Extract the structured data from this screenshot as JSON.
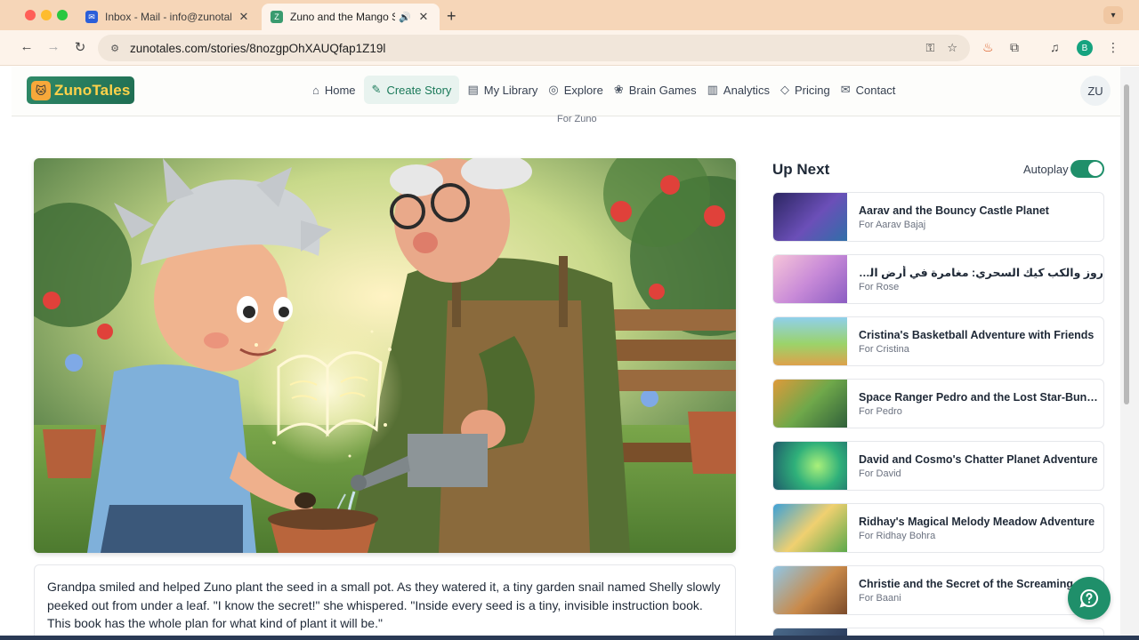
{
  "browser": {
    "tabs": [
      {
        "title": "Inbox - Mail - info@zunotales",
        "close": "✕"
      },
      {
        "title": "Zuno and the Mango Seed",
        "close": "✕"
      }
    ],
    "new_tab": "+",
    "url": "zunotales.com/stories/8nozgpOhXAUQfap1Z19l",
    "profile_initial": "B"
  },
  "site": {
    "logo_text": "ZunoTales",
    "nav": [
      {
        "label": "Home",
        "icon": "home-icon"
      },
      {
        "label": "Create Story",
        "icon": "magic-wand-icon"
      },
      {
        "label": "My Library",
        "icon": "book-icon"
      },
      {
        "label": "Explore",
        "icon": "compass-icon"
      },
      {
        "label": "Brain Games",
        "icon": "brain-icon"
      },
      {
        "label": "Analytics",
        "icon": "chart-icon"
      },
      {
        "label": "Pricing",
        "icon": "diamond-icon"
      },
      {
        "label": "Contact",
        "icon": "mail-icon"
      }
    ],
    "avatar_initials": "ZU",
    "story_for": "For Zuno"
  },
  "story": {
    "text": "Grandpa smiled and helped Zuno plant the seed in a small pot. As they watered it, a tiny garden snail named Shelly slowly peeked out from under a leaf. \"I know the secret!\" she whispered. \"Inside every seed is a tiny, invisible instruction book. This book has the whole plan for what kind of plant it will be.\""
  },
  "up_next": {
    "title": "Up Next",
    "autoplay_label": "Autoplay",
    "autoplay_on": true,
    "items": [
      {
        "title": "Aarav and the Bouncy Castle Planet",
        "sub": "For Aarav Bajaj"
      },
      {
        "title": "روز والكب كيك السحري: مغامرة في أرض الحلوى",
        "sub": "For Rose"
      },
      {
        "title": "Cristina's Basketball Adventure with Friends",
        "sub": "For Cristina"
      },
      {
        "title": "Space Ranger Pedro and the Lost Star-Bunnies",
        "sub": "For Pedro"
      },
      {
        "title": "David and Cosmo's Chatter Planet Adventure",
        "sub": "For David"
      },
      {
        "title": "Ridhay's Magical Melody Meadow Adventure",
        "sub": "For Ridhay Bohra"
      },
      {
        "title": "Christie and the Secret of the Screaming J",
        "sub": "For Baani"
      }
    ]
  },
  "colors": {
    "brand": "#1f8f6a",
    "tabbar": "#f6d6b8",
    "logo_yellow": "#ffd24a"
  }
}
